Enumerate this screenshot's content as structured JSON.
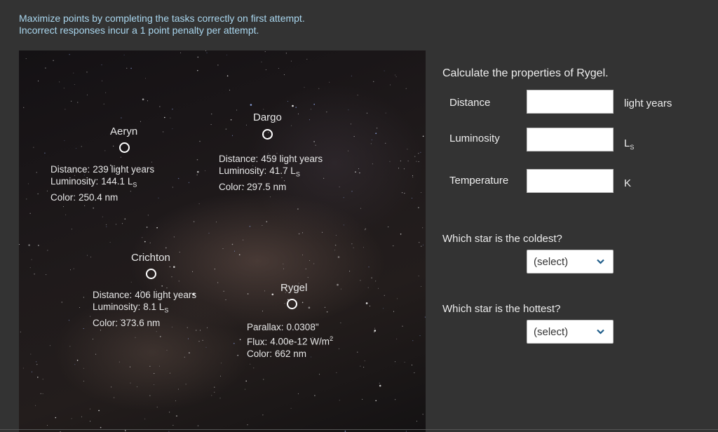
{
  "instructions": {
    "line1": "Maximize points by completing the tasks correctly on first attempt.",
    "line2": "Incorrect responses incur a 1 point penalty per attempt."
  },
  "stars": {
    "aeryn": {
      "name": "Aeryn",
      "distance_label": "Distance:",
      "distance_value": "239 light years",
      "luminosity_label": "Luminosity:",
      "luminosity_value": "144.1 L",
      "luminosity_sub": "S",
      "color_label": "Color:",
      "color_value": "250.4 nm"
    },
    "dargo": {
      "name": "Dargo",
      "distance_label": "Distance:",
      "distance_value": "459 light years",
      "luminosity_label": "Luminosity:",
      "luminosity_value": "41.7 L",
      "luminosity_sub": "S",
      "color_label": "Color:",
      "color_value": "297.5 nm"
    },
    "crichton": {
      "name": "Crichton",
      "distance_label": "Distance:",
      "distance_value": "406 light years",
      "luminosity_label": "Luminosity:",
      "luminosity_value": "8.1 L",
      "luminosity_sub": "S",
      "color_label": "Color:",
      "color_value": "373.6 nm"
    },
    "rygel": {
      "name": "Rygel",
      "parallax_label": "Parallax:",
      "parallax_value": "0.0308\"",
      "flux_label": "Flux:",
      "flux_value": "4.00e-12 W/m",
      "flux_sup": "2",
      "color_label": "Color:",
      "color_value": "662 nm"
    }
  },
  "task": {
    "title": "Calculate the properties of Rygel.",
    "distance_label": "Distance",
    "distance_value": "",
    "distance_unit": "light years",
    "luminosity_label": "Luminosity",
    "luminosity_value": "",
    "luminosity_unit": "L",
    "luminosity_unit_sub": "S",
    "temperature_label": "Temperature",
    "temperature_value": "",
    "temperature_unit": "K"
  },
  "questions": {
    "coldest_label": "Which star is the coldest?",
    "coldest_selected": "(select)",
    "hottest_label": "Which star is the hottest?",
    "hottest_selected": "(select)"
  },
  "colors": {
    "page_bg": "#333333",
    "instruction_text": "#a9d6ee",
    "chevron": "#1f5d8a"
  }
}
